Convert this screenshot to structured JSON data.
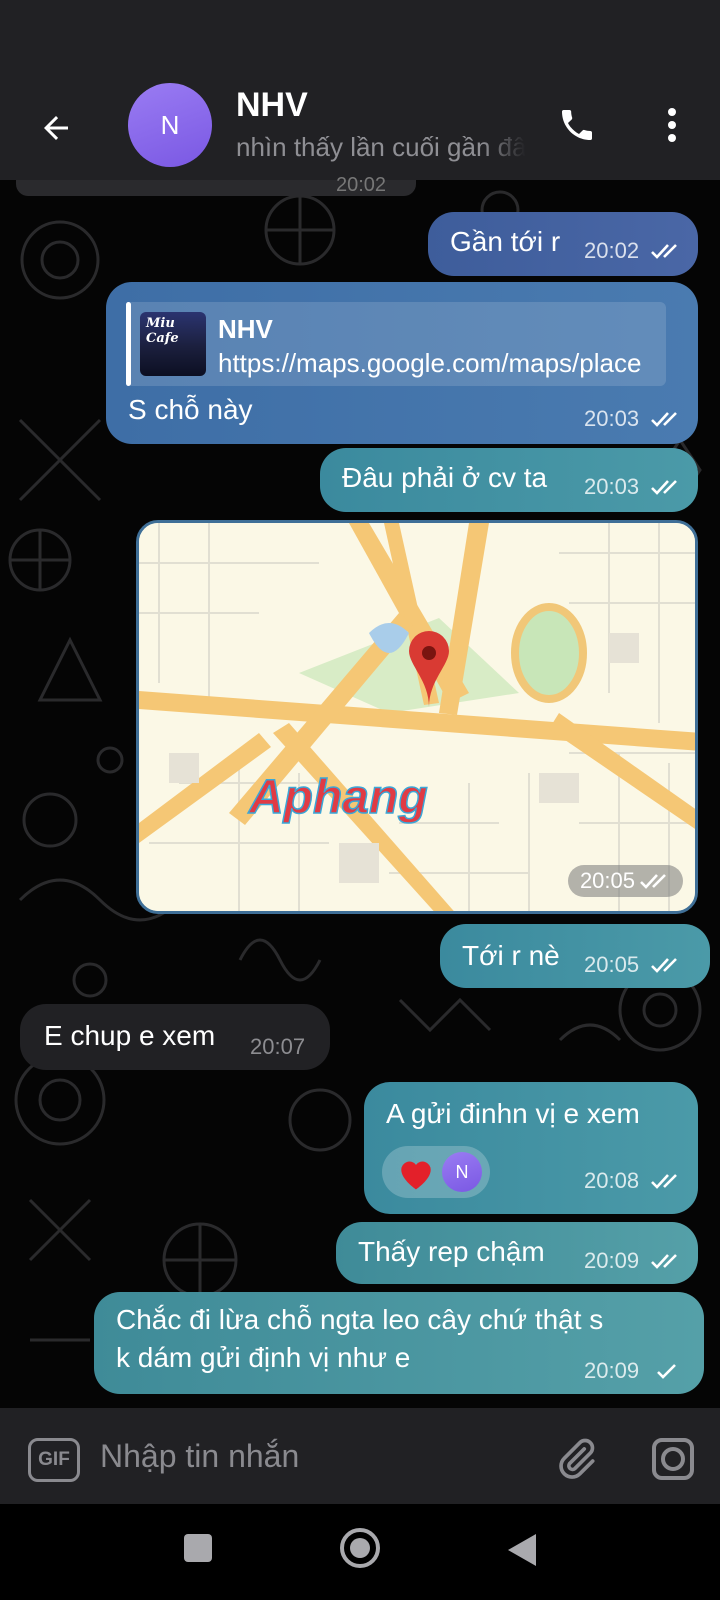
{
  "header": {
    "avatar_initial": "N",
    "contact_name": "NHV",
    "status_text": "nhìn thấy lần cuối gần đây",
    "date_separator": "20:02"
  },
  "messages": [
    {
      "id": "m1",
      "direction": "out",
      "text": "Gần tới r",
      "time": "20:02",
      "status": "read"
    },
    {
      "id": "m2",
      "direction": "out",
      "link_preview": {
        "title": "NHV",
        "url": "https://maps.google.com/maps/place",
        "thumb_text": "Miu Cafe"
      },
      "text": "S chỗ này",
      "time": "20:03",
      "status": "read"
    },
    {
      "id": "m3",
      "direction": "out",
      "text": "Đâu phải ở cv ta",
      "time": "20:03",
      "status": "read"
    },
    {
      "id": "m4",
      "direction": "out",
      "type": "location",
      "watermark": "Aphang",
      "time": "20:05",
      "status": "read"
    },
    {
      "id": "m5",
      "direction": "out",
      "text": "Tới r nè",
      "time": "20:05",
      "status": "read"
    },
    {
      "id": "m6",
      "direction": "in",
      "text": "E chup e xem",
      "time": "20:07"
    },
    {
      "id": "m7",
      "direction": "out",
      "text": "A gửi đinhn vị e xem",
      "reaction": {
        "emoji": "heart",
        "by_initial": "N"
      },
      "time": "20:08",
      "status": "read"
    },
    {
      "id": "m8",
      "direction": "out",
      "text": "Thấy rep chậm",
      "time": "20:09",
      "status": "read"
    },
    {
      "id": "m9",
      "direction": "out",
      "lines": [
        "Chắc đi lừa chỗ ngta leo cây chứ thật s",
        "k dám gửi định vị như e"
      ],
      "time": "20:09",
      "status": "sent"
    }
  ],
  "composer": {
    "gif_label": "GIF",
    "placeholder": "Nhập tin nhắn"
  },
  "icons": [
    "back-arrow-icon",
    "phone-icon",
    "more-vert-icon",
    "gif-icon",
    "paperclip-icon",
    "camera-icon",
    "map-pin-icon",
    "heart-icon",
    "double-check-icon",
    "single-check-icon"
  ],
  "colors": {
    "header_bg": "#212124",
    "avatar": "#8a6af0",
    "bubble_out_top": "#3e5d9b",
    "bubble_out_bottom": "#4b9aa8",
    "bubble_in": "#212124",
    "map_pin": "#d93a33"
  }
}
